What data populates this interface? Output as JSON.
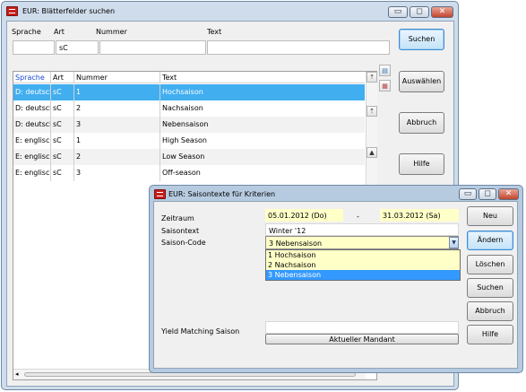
{
  "main_window": {
    "title": "EUR: Blätterfelder suchen",
    "controls": {
      "minimize": "▭",
      "maximize": "◻",
      "close": "✕"
    },
    "filter": {
      "labels": {
        "sprache": "Sprache",
        "art": "Art",
        "nummer": "Nummer",
        "text": "Text"
      },
      "values": {
        "sprache": "",
        "art": "sC",
        "nummer": "",
        "text": ""
      }
    },
    "buttons": {
      "suchen": "Suchen",
      "auswaehlen": "Auswählen",
      "abbruch": "Abbruch",
      "hilfe": "Hilfe"
    },
    "table": {
      "headers": [
        "Sprache",
        "Art",
        "Nummer",
        "Text"
      ],
      "rows": [
        [
          "D: deutsch",
          "sC",
          "1",
          "Hochsaison"
        ],
        [
          "D: deutsch",
          "sC",
          "2",
          "Nachsaison"
        ],
        [
          "D: deutsch",
          "sC",
          "3",
          "Nebensaison"
        ],
        [
          "E: englisch",
          "sC",
          "1",
          "High Season"
        ],
        [
          "E: englisch",
          "sC",
          "2",
          "Low Season"
        ],
        [
          "E: englisch",
          "sC",
          "3",
          "Off-season"
        ]
      ],
      "selected_row": 0
    }
  },
  "dialog": {
    "title": "EUR: Saisontexte für Kriterien",
    "controls": {
      "minimize": "▭",
      "maximize": "◻",
      "close": "✕"
    },
    "labels": {
      "zeitraum": "Zeitraum",
      "saisontext": "Saisontext",
      "saison_code": "Saison-Code",
      "yield": "Yield Matching Saison",
      "dash": "-"
    },
    "values": {
      "date_from": "05.01.2012 (Do)",
      "date_to": "31.03.2012 (Sa)",
      "saisontext": "Winter '12",
      "saison_code": "3 Nebensaison",
      "yield": ""
    },
    "dropdown_options": [
      "1 Hochsaison",
      "2 Nachsaison",
      "3 Nebensaison"
    ],
    "dropdown_selected": 2,
    "aktueller_mandant": "Aktueller Mandant",
    "buttons": {
      "neu": "Neu",
      "aendern": "Ändern",
      "loeschen": "Löschen",
      "suchen": "Suchen",
      "abbruch": "Abbruch",
      "hilfe": "Hilfe"
    }
  },
  "colors": {
    "selection": "#41aef0",
    "required_field": "#ffffc8",
    "close_button": "#c4452d"
  }
}
